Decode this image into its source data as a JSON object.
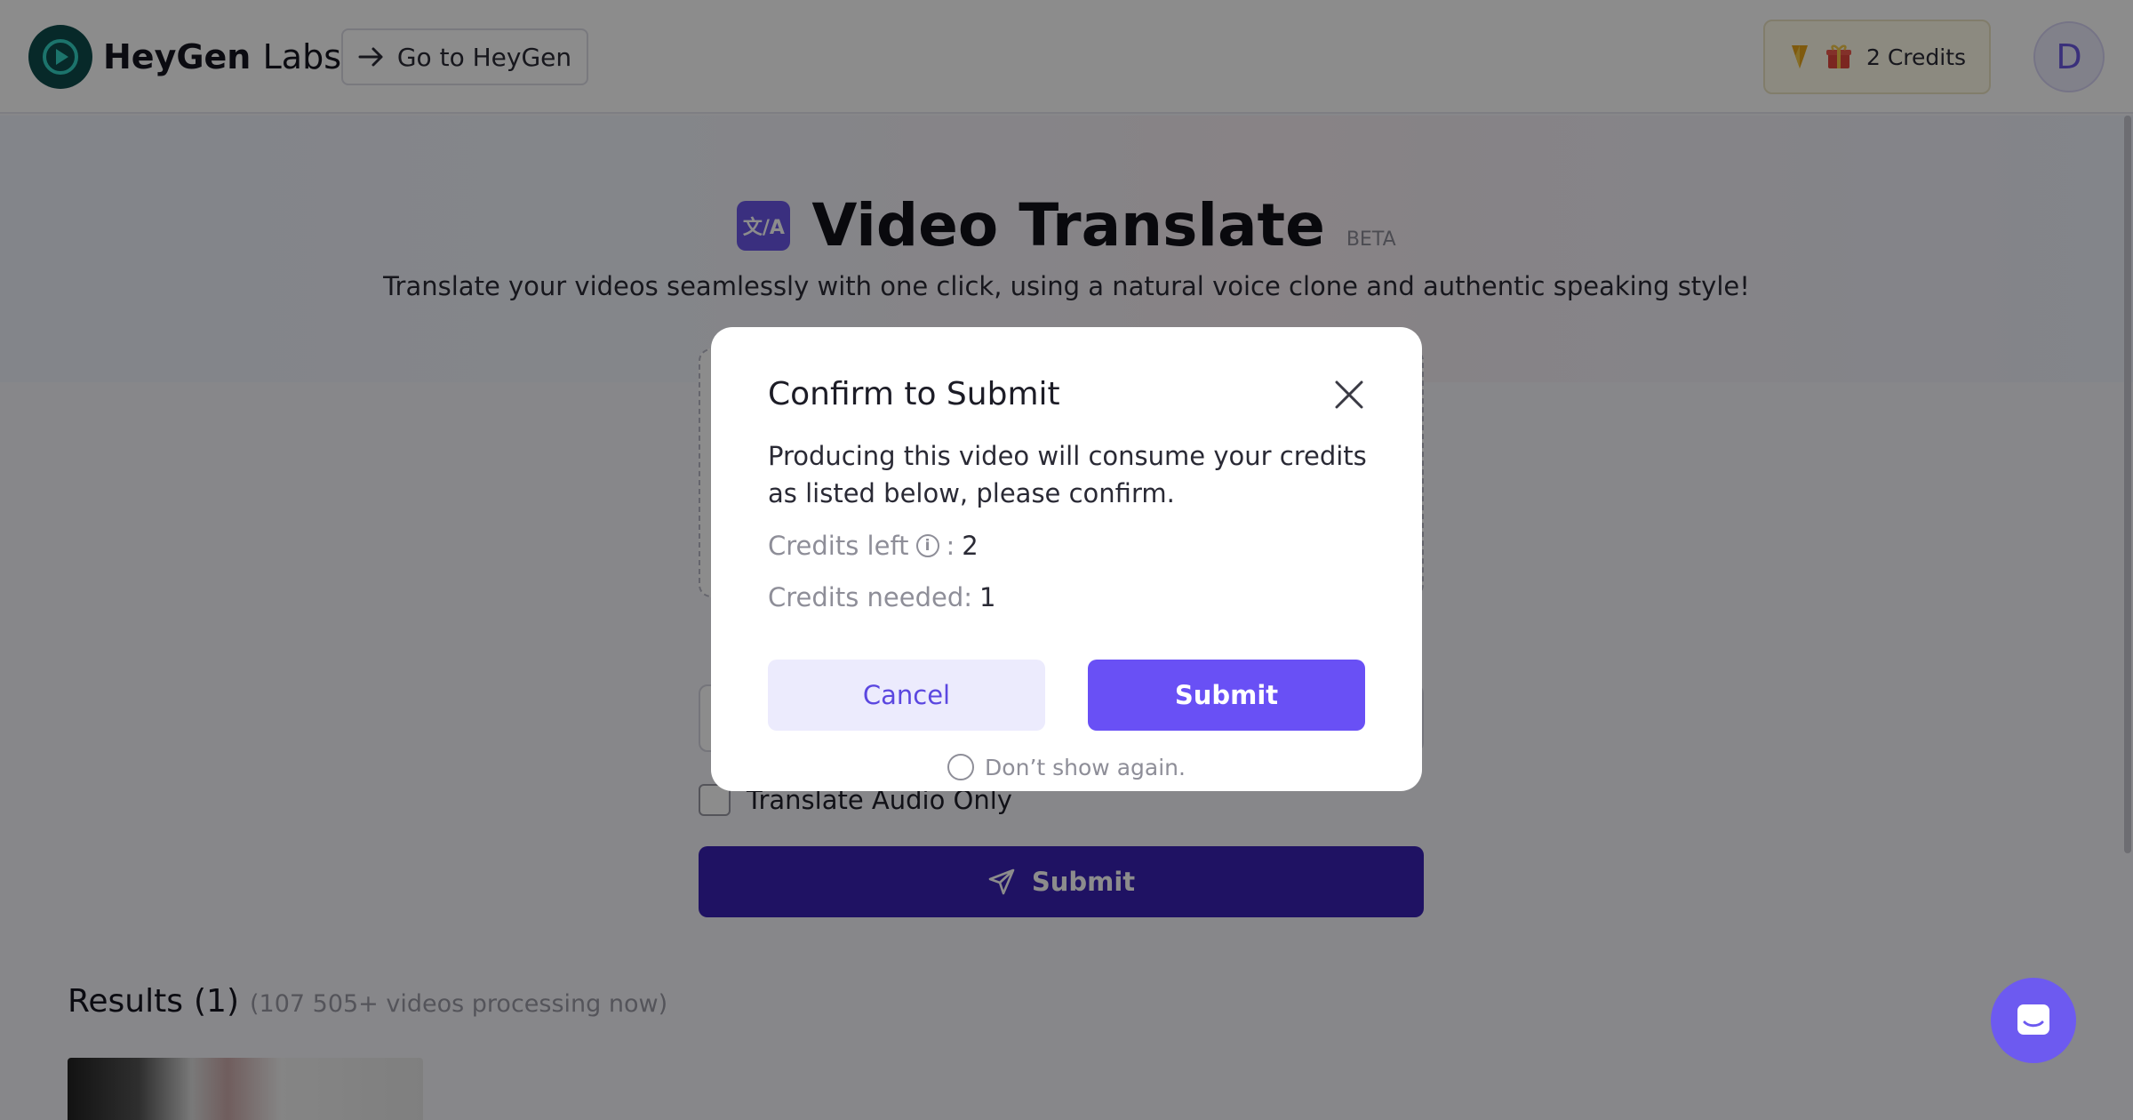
{
  "header": {
    "brand": "HeyGen",
    "brand_suffix": "Labs",
    "go_button": "Go to HeyGen",
    "credits_label": "2 Credits",
    "avatar_initial": "D"
  },
  "hero": {
    "icon_text": "文/A",
    "title": "Video Translate",
    "badge": "BETA",
    "subtitle": "Translate your videos seamlessly with one click, using a natural voice clone and authentic speaking style!"
  },
  "form": {
    "audio_only_label": "Translate Audio Only",
    "submit_label": "Submit"
  },
  "results": {
    "title": "Results",
    "count": "(1)",
    "note": "(107 505+ videos processing now)"
  },
  "modal": {
    "title": "Confirm to Submit",
    "body": "Producing this video will consume your credits as listed below, please confirm.",
    "credits_left_label": "Credits left",
    "credits_left_sep": ":",
    "credits_left_value": "2",
    "credits_needed_label": "Credits needed:",
    "credits_needed_value": "1",
    "cancel_label": "Cancel",
    "submit_label": "Submit",
    "dont_show_label": "Don’t show again."
  },
  "colors": {
    "accent": "#6950f5",
    "primary_dark": "#3a21b5",
    "cancel_bg": "#ecebfd"
  }
}
